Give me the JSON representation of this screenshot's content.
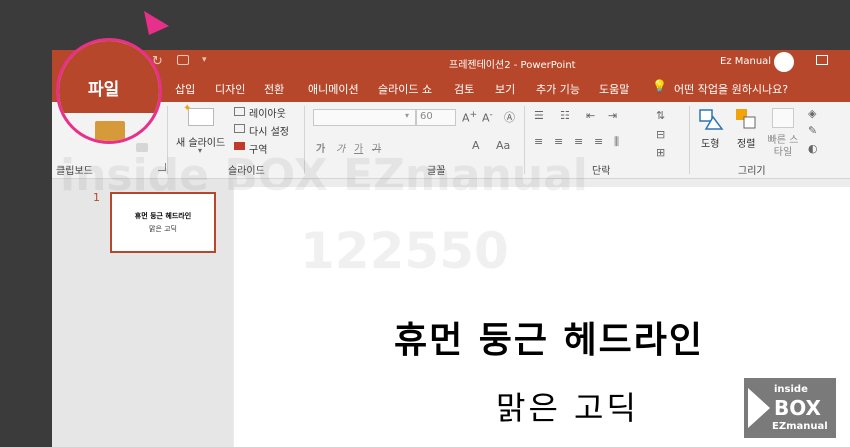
{
  "titlebar": {
    "title": "프레젠테이션2  -  PowerPoint",
    "user": "Ez Manual"
  },
  "tabs": [
    {
      "label": "삽입"
    },
    {
      "label": "디자인"
    },
    {
      "label": "전환"
    },
    {
      "label": "애니메이션"
    },
    {
      "label": "슬라이드 쇼"
    },
    {
      "label": "검토"
    },
    {
      "label": "보기"
    },
    {
      "label": "추가 기능"
    },
    {
      "label": "도움말"
    }
  ],
  "tell_me": "어떤 작업을 원하시나요?",
  "file_tab": "파일",
  "ribbon": {
    "clipboard": {
      "label": "클립보드",
      "paste": "붙여넣기"
    },
    "slides": {
      "label": "슬라이드",
      "new_slide": "새 슬라이드",
      "layout": "레이아웃",
      "reset": "다시 설정",
      "section": "구역"
    },
    "font": {
      "label": "글꼴",
      "size": "60",
      "bold": "가",
      "italic": "가",
      "underline": "가",
      "strike": "가"
    },
    "paragraph": {
      "label": "단락"
    },
    "drawing": {
      "label": "그리기",
      "shape": "도형",
      "arrange": "정렬",
      "quick_styles": "빠른 스타일"
    }
  },
  "slide_panel": {
    "number": "1",
    "thumb_title": "휴먼 둥근 헤드라인",
    "thumb_subtitle": "맑은 고딕"
  },
  "slide": {
    "title": "휴먼 둥근 헤드라인",
    "subtitle": "맑은 고딕"
  },
  "watermark": {
    "line1": "inside BOX EZmanual",
    "line2": "122550"
  },
  "logo": {
    "line1": "inside",
    "line2": "BOX",
    "line3": "EZmanual"
  },
  "colors": {
    "accent": "#b7472a",
    "highlight": "#e8308a"
  }
}
